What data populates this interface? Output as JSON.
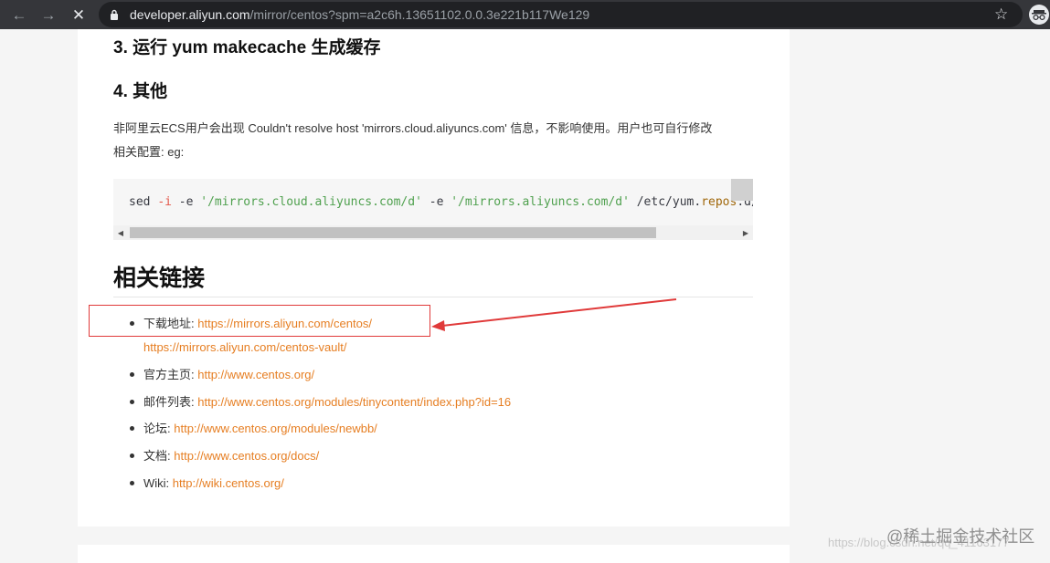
{
  "browser": {
    "back_icon": "arrow-left-icon",
    "forward_icon": "arrow-right-icon",
    "stop_icon": "close-icon",
    "url_host": "developer.aliyun.com",
    "url_path": "/mirror/centos?spm=a2c6h.13651102.0.0.3e221b117We129",
    "star_icon": "star-icon",
    "incognito_icon": "incognito-icon"
  },
  "content": {
    "heading_step3": "3. 运行 yum makecache 生成缓存",
    "heading_step4": "4. 其他",
    "note_line1": "非阿里云ECS用户会出现 Couldn't resolve host 'mirrors.cloud.aliyuncs.com' 信息，不影响使用。用户也可自行修改",
    "note_line2": "相关配置: eg:",
    "code": {
      "cmd": "sed ",
      "flag_i": "-i",
      "opt_e1": " -e ",
      "str1": "'/mirrors.cloud.aliyuncs.com/d'",
      "opt_e2": " -e ",
      "str2": "'/mirrors.aliyuncs.com/d'",
      "path_a": " /etc/yum.",
      "path_kw": "repos",
      "path_b": ".d/CentOS-*.repo"
    },
    "related_heading": "相关链接",
    "links": [
      {
        "label": "下载地址: ",
        "url": "https://mirrors.aliyun.com/centos/",
        "url2": "https://mirrors.aliyun.com/centos-vault/"
      },
      {
        "label": "官方主页: ",
        "url": "http://www.centos.org/"
      },
      {
        "label": "邮件列表: ",
        "url": "http://www.centos.org/modules/tinycontent/index.php?id=16"
      },
      {
        "label": "论坛: ",
        "url": "http://www.centos.org/modules/newbb/"
      },
      {
        "label": "文档: ",
        "url": "http://www.centos.org/docs/"
      },
      {
        "label": "Wiki: ",
        "url": "http://wiki.centos.org/"
      }
    ]
  },
  "annotation": {
    "color": "#e03a3a"
  },
  "watermark": {
    "text": "@稀土掘金技术社区",
    "url_fragment": "https://blog.csdn.net/qq_41163177"
  },
  "colors": {
    "link": "#e67e22",
    "toolbar": "#35363a",
    "omnibox": "#202124"
  }
}
